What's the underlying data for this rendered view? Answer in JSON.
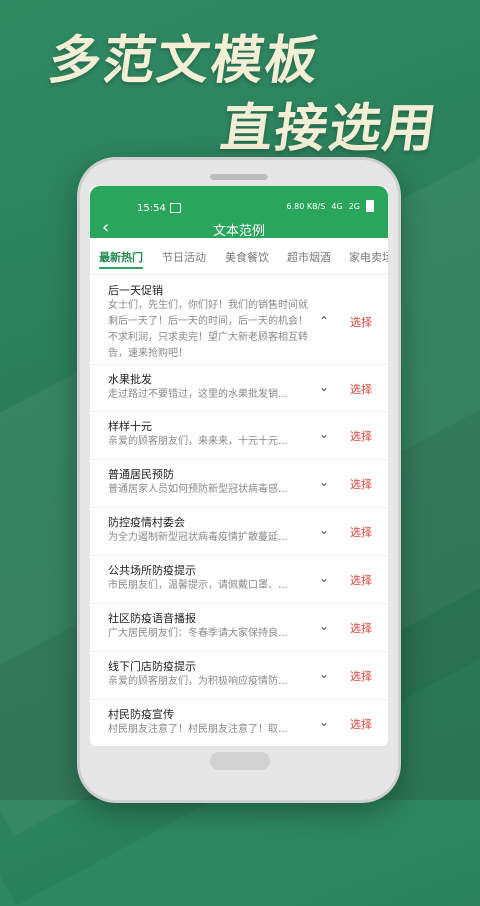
{
  "headline": {
    "line1": "多范文模板",
    "line2": "直接选用"
  },
  "status_bar": {
    "time": "15:54",
    "net": "6.80 KB/S",
    "signal1": "4G",
    "signal2": "2G"
  },
  "appbar": {
    "title": "文本范例"
  },
  "tabs": [
    {
      "label": "最新热门",
      "active": true
    },
    {
      "label": "节日活动",
      "active": false
    },
    {
      "label": "美食餐饮",
      "active": false
    },
    {
      "label": "超市烟酒",
      "active": false
    },
    {
      "label": "家电卖场",
      "active": false
    }
  ],
  "list": {
    "select_label": "选择",
    "items": [
      {
        "title": "后一天促销",
        "desc": "女士们，先生们，你们好！我们的销售时间就剩后一天了！后一天的时间，后一天的机会！不求利润，只求卖完！望广大新老顾客相互转告，速来抢购吧！",
        "expanded": true
      },
      {
        "title": "水果批发",
        "desc": "走过路过不要错过，这里的水果批发销…",
        "expanded": false
      },
      {
        "title": "样样十元",
        "desc": "亲爱的顾客朋友们，来来来，十元十元…",
        "expanded": false
      },
      {
        "title": "普通居民预防",
        "desc": "普通居家人员如何预防新型冠状病毒感…",
        "expanded": false
      },
      {
        "title": "防控疫情村委会",
        "desc": "为全力遏制新型冠状病毒疫情扩散蔓延…",
        "expanded": false
      },
      {
        "title": "公共场所防疫提示",
        "desc": "市民朋友们，温馨提示，请佩戴口罩、…",
        "expanded": false
      },
      {
        "title": "社区防疫语音播报",
        "desc": "广大居民朋友们：冬春季请大家保持良…",
        "expanded": false
      },
      {
        "title": "线下门店防疫提示",
        "desc": "亲爱的顾客朋友们，为积极响应疫情防…",
        "expanded": false
      },
      {
        "title": "村民防疫宣传",
        "desc": "村民朋友注意了！村民朋友注意了！取…",
        "expanded": false
      }
    ]
  }
}
